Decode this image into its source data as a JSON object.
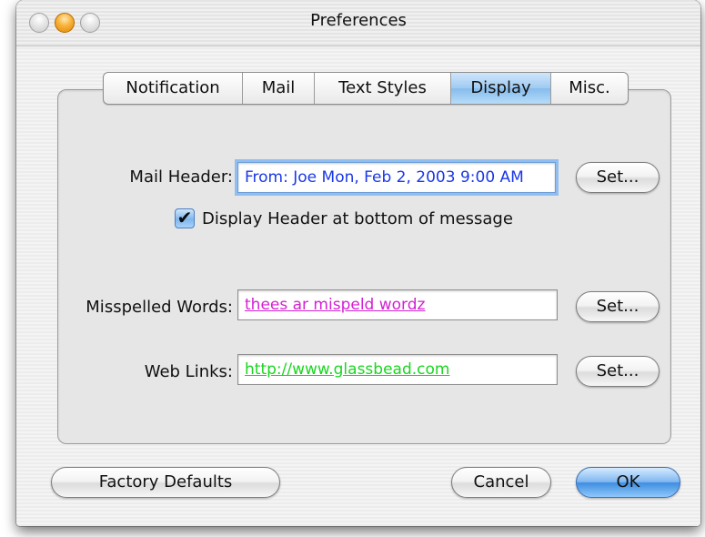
{
  "window": {
    "title": "Preferences"
  },
  "tabs": [
    {
      "label": "Notification",
      "active": false
    },
    {
      "label": "Mail",
      "active": false
    },
    {
      "label": "Text Styles",
      "active": false
    },
    {
      "label": "Display",
      "active": true
    },
    {
      "label": "Misc.",
      "active": false
    }
  ],
  "display": {
    "mail_header": {
      "label": "Mail Header:",
      "value": "From: Joe  Mon, Feb 2, 2003 9:00 AM",
      "color": "#1a38e8",
      "set_label": "Set..."
    },
    "header_bottom": {
      "label": "Display Header at bottom of message",
      "checked": true,
      "check_glyph": "✔"
    },
    "misspelled": {
      "label": "Misspelled Words:",
      "value": "thees ar mispeld wordz",
      "color": "#d41fd4",
      "set_label": "Set..."
    },
    "web_links": {
      "label": "Web Links:",
      "value": "http://www.glassbead.com",
      "color": "#19d61f",
      "set_label": "Set..."
    }
  },
  "footer": {
    "factory_defaults": "Factory Defaults",
    "cancel": "Cancel",
    "ok": "OK"
  },
  "colors": {
    "accent": "#6fa8e8",
    "window_bg": "#ececec"
  }
}
